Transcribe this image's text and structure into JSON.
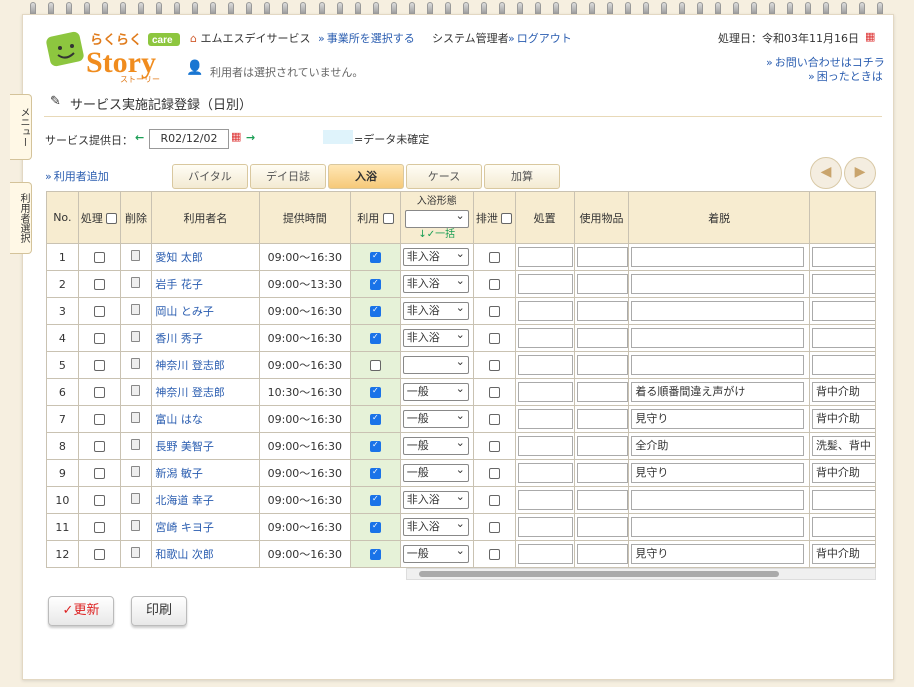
{
  "header": {
    "logo_text": "らくらくcare Story ストーリー",
    "office": "エムエスデイサービス",
    "select_office": "事業所を選択する",
    "admin": "システム管理者",
    "logout": "ログアウト",
    "process_date": "処理日：令和03年11月16日",
    "no_user": "利用者は選択されていません。",
    "contact": "お問い合わせはコチラ",
    "help": "困ったときは"
  },
  "side_tabs": {
    "menu": "メニュー",
    "user_select": "利用者選択"
  },
  "page_title": "サービス実施記録登録（日別）",
  "date_label": "サービス提供日：",
  "date_value": "R02/12/02",
  "legend_text": "=データ未確定",
  "add_user": "利用者追加",
  "tabs": [
    "バイタル",
    "デイ日誌",
    "入浴",
    "ケース",
    "加算"
  ],
  "table": {
    "headers": {
      "no": "No.",
      "process": "処理",
      "delete": "削除",
      "name": "利用者名",
      "time": "提供時間",
      "use": "利用",
      "bath_type": "入浴形態",
      "bulk": "✓一括",
      "excretion": "排泄",
      "treatment": "処置",
      "items": "使用物品",
      "dressing": "着脱"
    },
    "rows": [
      {
        "no": "1",
        "name": "愛知 太郎",
        "time": "09:00～16:30",
        "use": true,
        "bath": "非入浴",
        "dress": "",
        "extra": ""
      },
      {
        "no": "2",
        "name": "岩手 花子",
        "time": "09:00～13:30",
        "use": true,
        "bath": "非入浴",
        "dress": "",
        "extra": ""
      },
      {
        "no": "3",
        "name": "岡山 とみ子",
        "time": "09:00～16:30",
        "use": true,
        "bath": "非入浴",
        "dress": "",
        "extra": ""
      },
      {
        "no": "4",
        "name": "香川 秀子",
        "time": "09:00～16:30",
        "use": true,
        "bath": "非入浴",
        "dress": "",
        "extra": ""
      },
      {
        "no": "5",
        "name": "神奈川 登志郎",
        "time": "09:00～16:30",
        "use": false,
        "bath": "",
        "dress": "",
        "extra": ""
      },
      {
        "no": "6",
        "name": "神奈川 登志郎",
        "time": "10:30～16:30",
        "use": true,
        "bath": "一般",
        "dress": "着る順番間違え声がけ",
        "extra": "背中介助"
      },
      {
        "no": "7",
        "name": "富山 はな",
        "time": "09:00～16:30",
        "use": true,
        "bath": "一般",
        "dress": "見守り",
        "extra": "背中介助"
      },
      {
        "no": "8",
        "name": "長野 美智子",
        "time": "09:00～16:30",
        "use": true,
        "bath": "一般",
        "dress": "全介助",
        "extra": "洗髪、背中"
      },
      {
        "no": "9",
        "name": "新潟 敏子",
        "time": "09:00～16:30",
        "use": true,
        "bath": "一般",
        "dress": "見守り",
        "extra": "背中介助"
      },
      {
        "no": "10",
        "name": "北海道 幸子",
        "time": "09:00～16:30",
        "use": true,
        "bath": "非入浴",
        "dress": "",
        "extra": ""
      },
      {
        "no": "11",
        "name": "宮崎 キヨ子",
        "time": "09:00～16:30",
        "use": true,
        "bath": "非入浴",
        "dress": "",
        "extra": ""
      },
      {
        "no": "12",
        "name": "和歌山 次郎",
        "time": "09:00～16:30",
        "use": true,
        "bath": "一般",
        "dress": "見守り",
        "extra": "背中介助"
      }
    ]
  },
  "buttons": {
    "update": "✓更新",
    "print": "印刷"
  },
  "colors": {
    "accent": "#2a5db0",
    "header_bg": "#f7ecd0",
    "use_col": "#e6f2d8",
    "legend": "#dff3fb"
  }
}
